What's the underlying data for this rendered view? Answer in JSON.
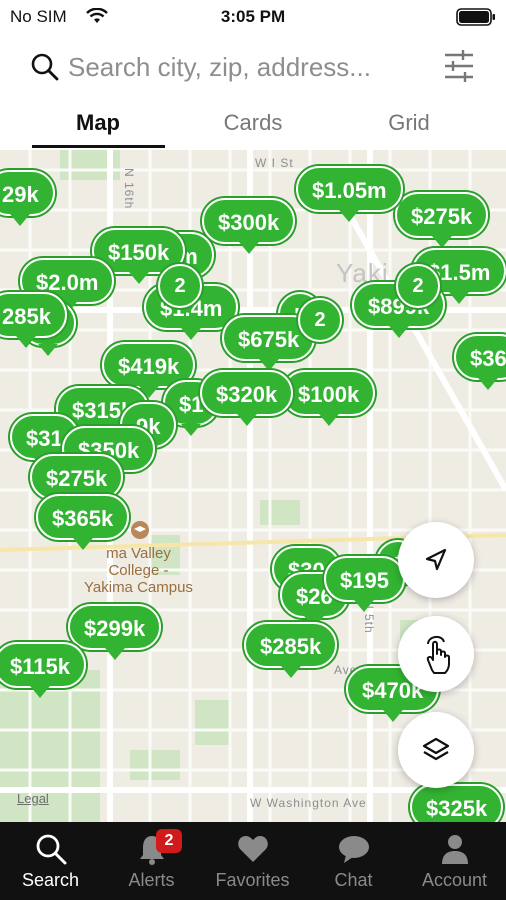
{
  "status_bar": {
    "carrier": "No SIM",
    "time": "3:05 PM"
  },
  "search": {
    "placeholder": "Search city, zip, address..."
  },
  "tabs": [
    {
      "label": "Map",
      "active": true
    },
    {
      "label": "Cards",
      "active": false
    },
    {
      "label": "Grid",
      "active": false
    }
  ],
  "map": {
    "street_labels": [
      "W I St",
      "N 16th",
      "N 5th",
      "W Washington Ave",
      "Ave"
    ],
    "city_label": "Yaki",
    "poi_label": [
      "ma Valley",
      "College -",
      "Yakima Campus"
    ],
    "legal": "Legal",
    "markers": [
      "29k",
      "$300k",
      "$1.05m",
      "$275k",
      "$150k",
      "9m",
      "$2.0m",
      "$1.5m",
      "285k",
      "0k",
      "$1.4m",
      "$899k",
      "k",
      "$675k",
      "$36",
      "$419k",
      "$315k",
      "$1",
      "$320k",
      "$100k",
      "$31",
      "9k",
      "$350k",
      "$275k",
      "$365k",
      "$30",
      "$195",
      "$",
      "$26",
      "$299k",
      "$285k",
      "$115k",
      "$470k",
      "$325k"
    ],
    "clusters": [
      "2",
      "2",
      "2"
    ]
  },
  "fabs": {
    "locate_icon": "navigation-arrow-icon",
    "draw_icon": "hand-draw-icon",
    "layers_icon": "layers-icon"
  },
  "bottom_nav": [
    {
      "label": "Search",
      "icon": "search-icon",
      "active": true
    },
    {
      "label": "Alerts",
      "icon": "bell-icon",
      "badge": "2",
      "active": false
    },
    {
      "label": "Favorites",
      "icon": "heart-icon",
      "active": false
    },
    {
      "label": "Chat",
      "icon": "chat-icon",
      "active": false
    },
    {
      "label": "Account",
      "icon": "person-icon",
      "active": false
    }
  ],
  "colors": {
    "marker_green": "#32b332",
    "nav_background": "#111111",
    "badge_red": "#d11a1a"
  }
}
